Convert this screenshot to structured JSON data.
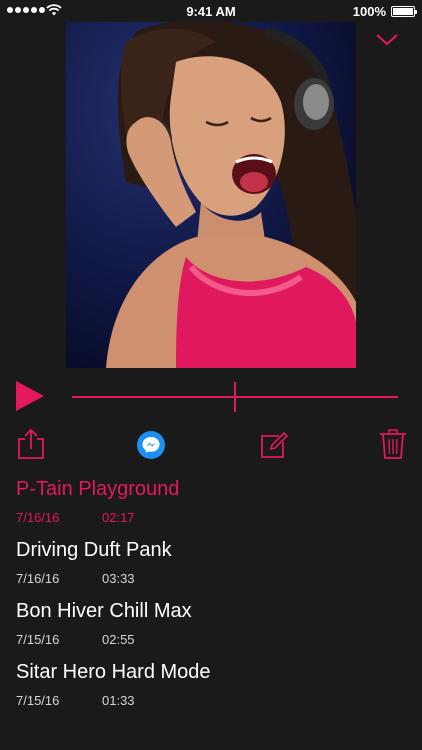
{
  "status_bar": {
    "time": "9:41 AM",
    "battery": "100%",
    "signal_icon": "signal-dots-icon",
    "wifi_icon": "wifi-icon",
    "battery_icon": "battery-icon"
  },
  "player": {
    "artwork": "photo of a woman wearing headphones, singing",
    "collapse_icon": "chevron-down-icon",
    "play_icon": "play-icon",
    "progress": 0.5
  },
  "actions": {
    "share_icon": "share-icon",
    "messenger_icon": "messenger-icon",
    "edit_icon": "edit-icon",
    "trash_icon": "trash-icon"
  },
  "recordings": [
    {
      "title": "P-Tain Playground",
      "date": "7/16/16",
      "duration": "02:17",
      "active": true
    },
    {
      "title": "Driving Duft Pank",
      "date": "7/16/16",
      "duration": "03:33",
      "active": false
    },
    {
      "title": "Bon Hiver Chill Max",
      "date": "7/15/16",
      "duration": "02:55",
      "active": false
    },
    {
      "title": "Sitar Hero Hard Mode",
      "date": "7/15/16",
      "duration": "01:33",
      "active": false
    }
  ],
  "colors": {
    "accent": "#e4185f",
    "background": "#1a1a1a",
    "messenger_blue": "#1d8ff2"
  }
}
